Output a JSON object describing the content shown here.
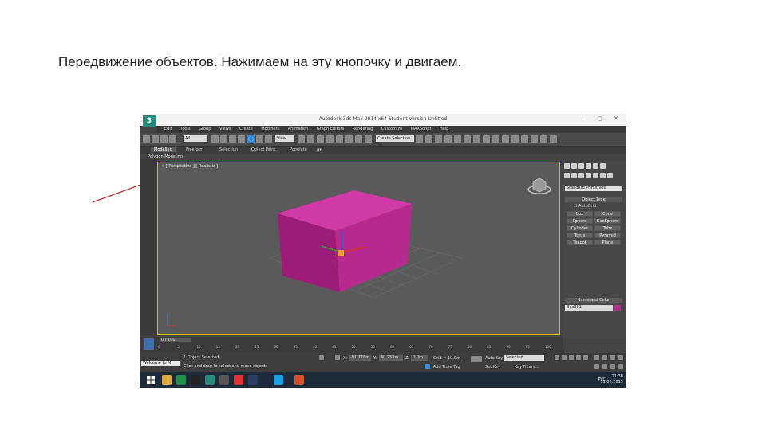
{
  "slide": {
    "title": "Передвижение объектов. Нажимаем на эту кнопочку и двигаем."
  },
  "app": {
    "window_title": "Autodesk 3ds Max 2014 x64    Student Version    Untitled",
    "logo_glyph": "3",
    "window_buttons": "–  ▢  ✕",
    "menu": [
      "Edit",
      "Tools",
      "Group",
      "Views",
      "Create",
      "Modifiers",
      "Animation",
      "Graph Editors",
      "Rendering",
      "Customize",
      "MAXScript",
      "Help"
    ],
    "selection_filter": "All",
    "ref_coord": "View",
    "named_selection": "Create Selection Se",
    "ribbon_tabs": [
      "Modeling",
      "Freeform",
      "Selection",
      "Object Paint",
      "Populate"
    ],
    "polygon_label": "Polygon Modeling",
    "viewport_label": "+ [ Perspective ] [ Realistic ]",
    "move_tool_highlight": "#3c8fd6"
  },
  "command_panel": {
    "category": "Standard Primitives",
    "rollout_object_type": "Object Type",
    "autogrid": "AutoGrid",
    "buttons": [
      "Box",
      "Cone",
      "Sphere",
      "GeoSphere",
      "Cylinder",
      "Tube",
      "Torus",
      "Pyramid",
      "Teapot",
      "Plane"
    ],
    "rollout_name_color": "Name and Color",
    "object_name": "Box001",
    "object_color": "#b62a8e"
  },
  "timeline": {
    "slider": "0 / 100",
    "ticks": [
      "0",
      "5",
      "10",
      "15",
      "20",
      "25",
      "30",
      "35",
      "40",
      "45",
      "50",
      "55",
      "60",
      "65",
      "70",
      "75",
      "80",
      "85",
      "90",
      "95",
      "100"
    ]
  },
  "status": {
    "welcome": "Welcome to M",
    "selected": "1 Object Selected",
    "prompt": "Click and drag to select and move objects",
    "x_label": "X:",
    "x_value": "-91,778m",
    "y_label": "Y:",
    "y_value": "40,758m",
    "z_label": "Z:",
    "z_value": "0,0m",
    "grid": "Grid = 10,0m",
    "add_time_tag": "Add Time Tag",
    "auto_key": "Auto Key",
    "auto_key_mode": "Selected",
    "set_key": "Set Key",
    "key_filters": "Key Filters..."
  },
  "taskbar": {
    "lang": "РУС",
    "time": "21:38",
    "date": "31.08.2015"
  }
}
